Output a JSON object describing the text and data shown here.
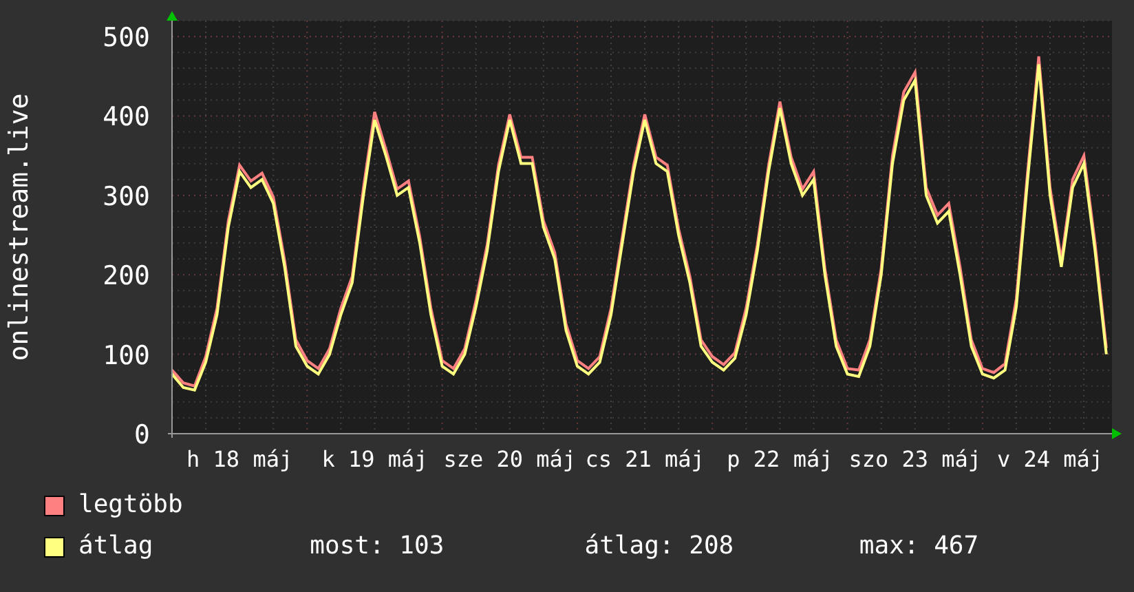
{
  "chart_data": {
    "type": "line",
    "ylabel": "onlinestream.live",
    "categories": [
      null,
      null,
      null,
      null,
      null,
      null,
      "h 18 máj",
      null,
      null,
      null,
      null,
      null,
      null,
      null,
      null,
      null,
      null,
      null,
      "k 19 máj",
      null,
      null,
      null,
      null,
      null,
      null,
      null,
      null,
      null,
      null,
      null,
      "sze 20 máj",
      null,
      null,
      null,
      null,
      null,
      null,
      null,
      null,
      null,
      null,
      null,
      "cs 21 máj",
      null,
      null,
      null,
      null,
      null,
      null,
      null,
      null,
      null,
      null,
      null,
      "p 22 máj",
      null,
      null,
      null,
      null,
      null,
      null,
      null,
      null,
      null,
      null,
      null,
      "szo 23 máj",
      null,
      null,
      null,
      null,
      null,
      null,
      null,
      null,
      null,
      null,
      null,
      "v 24 máj",
      null,
      null,
      null,
      null,
      null
    ],
    "ylim": [
      0,
      520
    ],
    "grid": true,
    "yticks": [
      0,
      100,
      200,
      300,
      400,
      500
    ],
    "series": [
      {
        "name": "legtöbb",
        "color": "#ff8080",
        "values": [
          80,
          64,
          60,
          97,
          158,
          268,
          338,
          318,
          328,
          298,
          218,
          118,
          92,
          82,
          107,
          158,
          198,
          310,
          405,
          358,
          308,
          318,
          248,
          158,
          92,
          82,
          107,
          168,
          238,
          338,
          402,
          348,
          348,
          268,
          228,
          138,
          92,
          82,
          97,
          158,
          248,
          338,
          402,
          348,
          338,
          258,
          198,
          118,
          97,
          87,
          102,
          158,
          238,
          338,
          418,
          348,
          308,
          330,
          208,
          118,
          82,
          80,
          118,
          208,
          350,
          430,
          455,
          310,
          275,
          290,
          210,
          118,
          82,
          77,
          88,
          170,
          330,
          475,
          310,
          218,
          320,
          350,
          240,
          108
        ]
      },
      {
        "name": "átlag",
        "color": "#ffff80",
        "values": [
          75,
          58,
          55,
          90,
          150,
          260,
          330,
          310,
          320,
          290,
          210,
          110,
          85,
          75,
          100,
          150,
          190,
          300,
          395,
          350,
          300,
          310,
          240,
          150,
          85,
          75,
          100,
          160,
          230,
          330,
          395,
          340,
          340,
          260,
          220,
          130,
          85,
          75,
          90,
          150,
          240,
          330,
          395,
          340,
          330,
          250,
          190,
          110,
          90,
          80,
          95,
          150,
          230,
          330,
          410,
          340,
          300,
          320,
          200,
          110,
          75,
          72,
          110,
          200,
          340,
          420,
          445,
          300,
          265,
          280,
          200,
          110,
          75,
          70,
          80,
          160,
          320,
          465,
          300,
          210,
          310,
          340,
          230,
          100
        ]
      }
    ]
  },
  "stats": [
    "most: 103",
    "átlag: 208",
    "max: 467"
  ]
}
